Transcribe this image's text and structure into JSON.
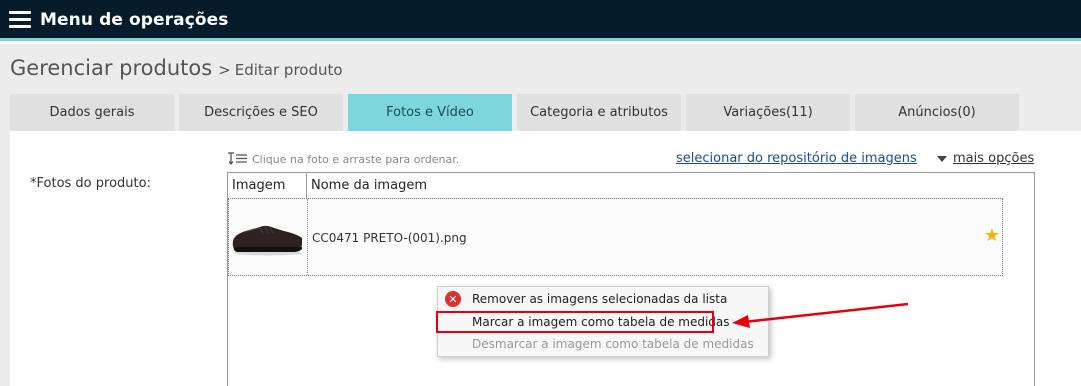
{
  "app": {
    "title": "Menu de operações"
  },
  "breadcrumb": {
    "main": "Gerenciar produtos",
    "separator": ">",
    "current": "Editar produto"
  },
  "tabs": [
    {
      "label": "Dados gerais"
    },
    {
      "label": "Descrições e SEO"
    },
    {
      "label": "Fotos e Vídeo"
    },
    {
      "label": "Categoria e atributos"
    },
    {
      "label": "Variações(11)"
    },
    {
      "label": "Anúncios(0)"
    }
  ],
  "active_tab": "Fotos e Vídeo",
  "photos": {
    "field_label": "*Fotos do produto:",
    "hint": "Clique na foto e arraste para ordenar.",
    "repository_link": "selecionar do repositório de imagens",
    "more_options": "mais opções",
    "table": {
      "headers": [
        "Imagem",
        "Nome da imagem"
      ],
      "rows": [
        {
          "thumbnail": "shoe-thumbnail",
          "name": "CC0471 PRETO-(001).png",
          "main_image_icon": "star-icon"
        }
      ]
    }
  },
  "context_menu": {
    "items": [
      {
        "label": "Remover as imagens selecionadas da lista",
        "icon": "remove-icon",
        "enabled": true
      },
      {
        "label": "Marcar a imagem como tabela de medidas",
        "enabled": true,
        "highlighted": true
      },
      {
        "label": "Desmarcar a imagem como tabela de medidas",
        "enabled": false
      }
    ]
  },
  "colors": {
    "topbar": "#071c2a",
    "accent": "#7dd6dc",
    "link": "#1a4ba3",
    "annotation": "#e3000f",
    "star": "#f2b705"
  }
}
